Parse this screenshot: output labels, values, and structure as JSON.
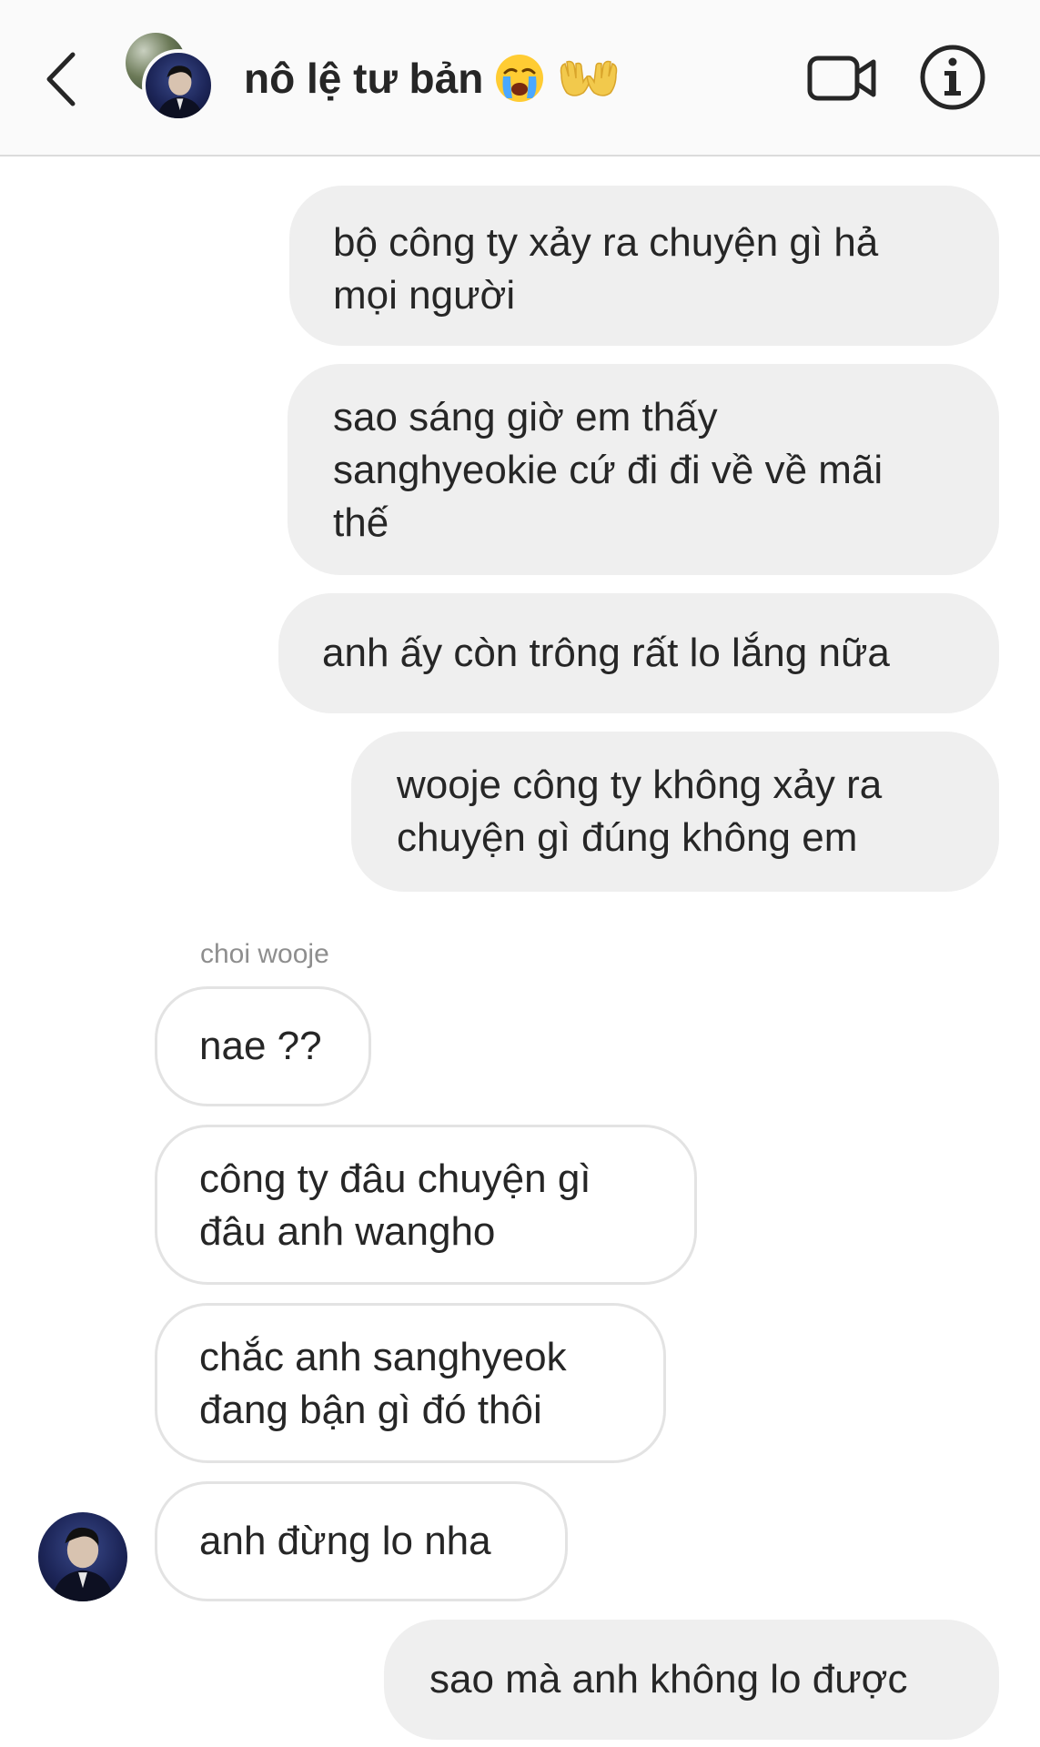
{
  "header": {
    "title": "nô lệ tư bản",
    "icons": {
      "back": "chevron-left-icon",
      "video": "video-camera-icon",
      "info": "info-circle-icon",
      "emoji_1": "loudly-crying-face-emoji",
      "emoji_2": "open-hands-emoji"
    }
  },
  "thread": {
    "messages": [
      {
        "direction": "outgoing",
        "text": "bộ công ty xảy ra chuyện gì hả\nmọi người"
      },
      {
        "direction": "outgoing",
        "text": "sao sáng giờ em thấy\nsanghyeokie cứ đi đi về về mãi\nthế"
      },
      {
        "direction": "outgoing",
        "text": "anh ấy còn trông rất lo lắng nữa"
      },
      {
        "direction": "outgoing",
        "text": "wooje công ty không xảy ra\nchuyện gì đúng không em"
      },
      {
        "direction": "incoming",
        "text": "nae ??"
      },
      {
        "direction": "incoming",
        "text": "công ty đâu chuyện gì\nđâu anh wangho"
      },
      {
        "direction": "incoming",
        "text": "chắc anh sanghyeok\nđang bận gì đó thôi"
      },
      {
        "direction": "incoming",
        "text": "anh đừng lo nha"
      },
      {
        "direction": "outgoing",
        "text": "sao mà anh không lo được"
      }
    ],
    "incoming_sender_name": "choi wooje"
  },
  "colors": {
    "header_bg": "#fafafa",
    "outgoing_bubble": "#efefef",
    "incoming_border": "#e3e3e3",
    "text": "#262626",
    "muted": "#8e8e8e"
  }
}
